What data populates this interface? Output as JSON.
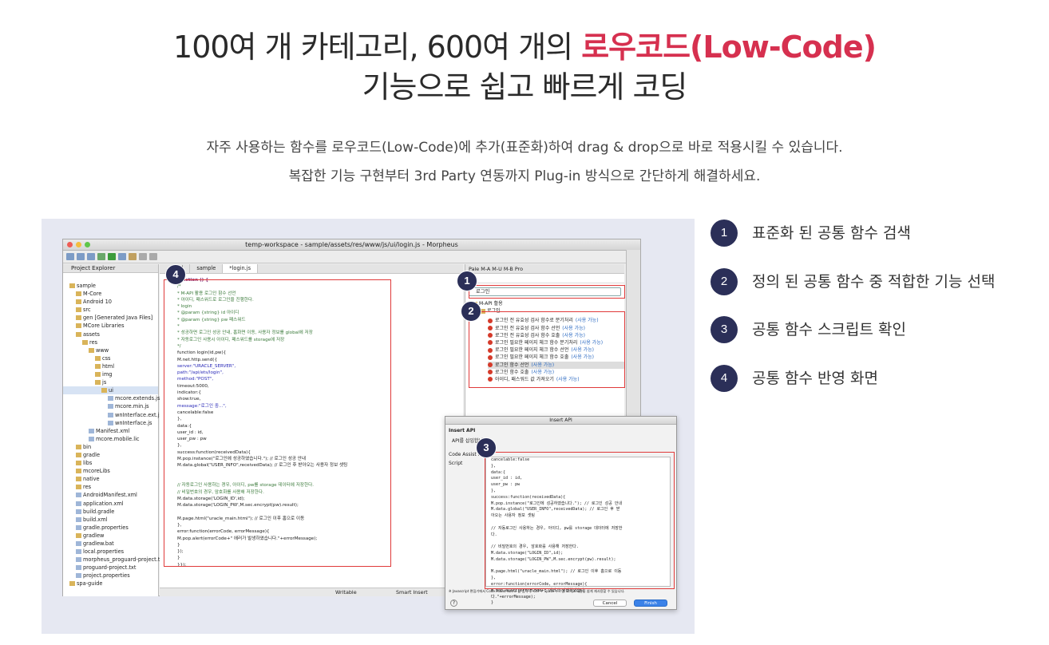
{
  "hero": {
    "title_line1_a": "100여 개 카테고리, 600여 개의 ",
    "title_line1_highlight": "로우코드(Low-Code)",
    "title_line2": "기능으로 쉽고 빠르게 코딩",
    "desc_line1": "자주 사용하는 함수를 로우코드(Low-Code)에 추가(표준화)하여 drag & drop으로 바로 적용시킬 수 있습니다.",
    "desc_line2": "복잡한 기능 구현부터 3rd Party 연동까지 Plug-in 방식으로 간단하게 해결하세요."
  },
  "colors": {
    "accent": "#d6304f",
    "badge": "#2b2f58",
    "highlight_box": "#e03a3a"
  },
  "ide": {
    "window_title": "temp-workspace - sample/assets/res/www/js/ui/login.js - Morpheus",
    "project_explorer_title": "Project Explorer",
    "tree": [
      "sample",
      "M-Core",
      "Android 10",
      "src",
      "gen [Generated Java Files]",
      "MCore Libraries",
      "assets",
      "res",
      "www",
      "css",
      "html",
      "img",
      "js",
      "ui",
      "mcore.extends.js",
      "mcore.min.js",
      "wnInterface.ext.js",
      "wnInterface.js",
      "Manifest.xml",
      "mcore.mobile.lic",
      "bin",
      "gradle",
      "libs",
      "mcoreLibs",
      "native",
      "res",
      "AndroidManifest.xml",
      "application.xml",
      "build.gradle",
      "build.xml",
      "gradle.properties",
      "gradlew",
      "gradlew.bat",
      "local.properties",
      "morpheus_proguard-project.txt",
      "proguard-project.txt",
      "project.properties",
      "spa-guide"
    ],
    "editor_tabs": [
      "...html",
      "sample",
      "*login.js"
    ],
    "code": [
      {
        "t": "function () {",
        "c": "k"
      },
      {
        "t": "/*",
        "c": "c"
      },
      {
        "t": " * M-API 활용 로그인 함수 선언",
        "c": "c"
      },
      {
        "t": " * 아이디, 패스워드로 로그인을 진행한다.",
        "c": "c"
      },
      {
        "t": " * login",
        "c": "c"
      },
      {
        "t": " * @param {string} id 아이디",
        "c": "c"
      },
      {
        "t": " * @param {string} pw 패스워드",
        "c": "c"
      },
      {
        "t": " *",
        "c": "c"
      },
      {
        "t": " * 성공하면 로그인 성공 안내, 홈화면 이동, 사용자 정보를 global에 저장",
        "c": "c"
      },
      {
        "t": " * 자동로그인 사용시 아이디, 패스워드를 storage에 저장",
        "c": "c"
      },
      {
        "t": " */",
        "c": "c"
      },
      {
        "t": "function login(id,pw){",
        "c": ""
      },
      {
        "t": "  M.net.http.send({",
        "c": ""
      },
      {
        "t": "    server:\"URACLE_SERVER\",",
        "c": "s"
      },
      {
        "t": "    path:\"/api/ets/login\",",
        "c": "s"
      },
      {
        "t": "    method:\"POST\",",
        "c": "s"
      },
      {
        "t": "    timeout:5000,",
        "c": ""
      },
      {
        "t": "    indicator:{",
        "c": ""
      },
      {
        "t": "      show:true,",
        "c": ""
      },
      {
        "t": "      message:\"로그인 중...\",",
        "c": "s"
      },
      {
        "t": "      cancelable:false",
        "c": ""
      },
      {
        "t": "    },",
        "c": ""
      },
      {
        "t": "    data:{",
        "c": ""
      },
      {
        "t": "      user_id : id,",
        "c": ""
      },
      {
        "t": "      user_pw : pw",
        "c": ""
      },
      {
        "t": "    },",
        "c": ""
      },
      {
        "t": "    success:function(receivedData){",
        "c": ""
      },
      {
        "t": "      M.pop.instance(\"로그인에 성공하였습니다.\"); // 로그인 성공 안내",
        "c": ""
      },
      {
        "t": "      M.data.global(\"USER_INFO\",receivedData); // 로그인 후 받아오는 사용자 정보 셋팅",
        "c": ""
      },
      {
        "t": "",
        "c": ""
      },
      {
        "t": "",
        "c": ""
      },
      {
        "t": "      // 자동로그인 사용하는 경우, 아이디, pw를 storage 데이터에 저장한다.",
        "c": "c"
      },
      {
        "t": "      // 비밀번호의 경우, 암호화를 사용해 저장한다.",
        "c": "c"
      },
      {
        "t": "      M.data.storage('LOGIN_ID',id);",
        "c": ""
      },
      {
        "t": "      M.data.storage('LOGIN_PW',M.sec.encrypt(pw).result);",
        "c": ""
      },
      {
        "t": "",
        "c": ""
      },
      {
        "t": "      M.page.html(\"uracle_main.html\"); // 로그인 이후 홈으로 이동",
        "c": ""
      },
      {
        "t": "    },",
        "c": ""
      },
      {
        "t": "    error:function(errorCode, errorMessage){",
        "c": ""
      },
      {
        "t": "      M.pop.alert(errorCode+\" 에러가 발생하였습니다.\"+errorMessage);",
        "c": ""
      },
      {
        "t": "    }",
        "c": ""
      },
      {
        "t": "  });",
        "c": ""
      },
      {
        "t": "}",
        "c": ""
      },
      {
        "t": "}});",
        "c": ""
      }
    ],
    "right_tabs": "Pale  M-A  M-U  M-B  Pro",
    "search_value": "로그인",
    "tree_head": "M-API 활용",
    "tree_sub": "로그인",
    "api_items": [
      {
        "label": "로그인 전 유효성 검사 함수로 분기처리",
        "tag": "(사용 가능)"
      },
      {
        "label": "로그인 전 유효성 검사 함수 선언",
        "tag": "(사용 가능)"
      },
      {
        "label": "로그인 전 유효성 검사 함수 호출",
        "tag": "(사용 가능)"
      },
      {
        "label": "로그인 필요한 페이지 체크 함수 분기처리",
        "tag": "(사용 가능)"
      },
      {
        "label": "로그인 필요한 페이지 체크 함수 선언",
        "tag": "(사용 가능)"
      },
      {
        "label": "로그인 필요한 페이지 체크 함수 호출",
        "tag": "(사용 가능)"
      },
      {
        "label": "로그인 함수 선언",
        "tag": "(사용 가능)"
      },
      {
        "label": "로그인 함수 호출",
        "tag": "(사용 가능)"
      },
      {
        "label": "아이디, 패스워드 값 가져오기",
        "tag": "(사용 가능)"
      }
    ],
    "status_writable": "Writable",
    "status_insert": "Smart Insert"
  },
  "dialog": {
    "title": "Insert API",
    "heading": "Insert API",
    "subheading": "API를 삽입합니다.",
    "field1": "Code Assist Name",
    "field2": "Script",
    "code": [
      "      cancelable:false",
      "    },",
      "    data:{",
      "      user_id : id,",
      "      user_pw : pw",
      "    },",
      "    success:function(receivedData){",
      "      M.pop.instance(\"로그인에 성공하였습니다.\"); // 로그인 성공 안내",
      "      M.data.global(\"USER_INFO\",receivedData); // 로그인 후 받",
      "아오는 사용자 정보 셋팅",
      "",
      "      // 자동로그인 사용하는 경우, 아이디, pw를 storage 데이터에 저장한",
      "다.",
      "",
      "      // 비밀번호의 경우, 암호화를 사용해 저장한다.",
      "      M.data.storage(\"LOGIN_ID\",id);",
      "      M.data.storage(\"LOGIN_PW\",M.sec.encrypt(pw).result);",
      "",
      "      M.page.html(\"uracle_main.html\"); // 로그인 이후 홈으로 이동",
      "    },",
      "    error:function(errorCode, errorMessage){",
      "      M.pop.alert(errorCode+\" 에러가 발생하였습니",
      "다.\"+errorMessage);",
      "    }"
    ],
    "footer_note": "※ Javascript 편집기에서 Code Assist Name 을 입력 후 Ctrl + Space 누르면 Script 내용을 쉽게 재사용할 수 있습니다.",
    "help": "?",
    "cancel": "Cancel",
    "finish": "Finish"
  },
  "badges": [
    "1",
    "2",
    "3",
    "4"
  ],
  "legend": [
    {
      "num": "1",
      "text": "표준화 된 공통 함수 검색"
    },
    {
      "num": "2",
      "text": "정의 된 공통 함수 중 적합한 기능 선택"
    },
    {
      "num": "3",
      "text": "공통 함수 스크립트 확인"
    },
    {
      "num": "4",
      "text": "공통 함수 반영 화면"
    }
  ]
}
